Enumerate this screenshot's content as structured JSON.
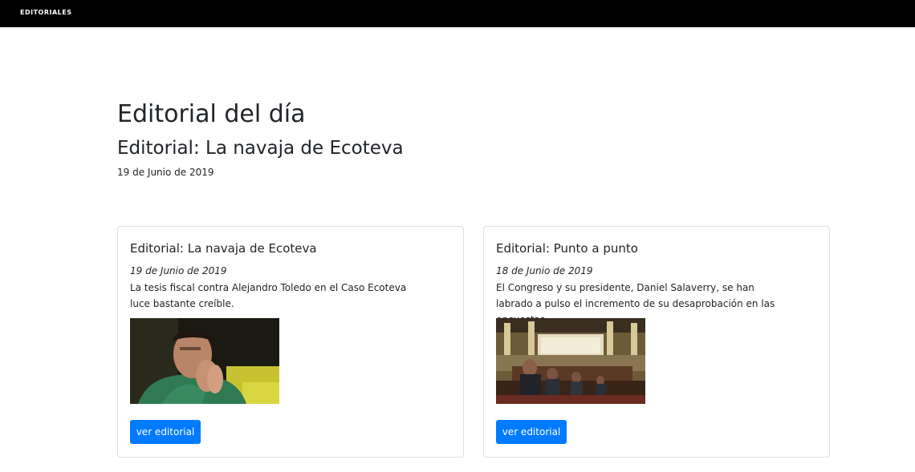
{
  "navbar": {
    "brand": "EDITORIALES"
  },
  "hero": {
    "heading": "Editorial del día",
    "title": "Editorial: La navaja de Ecoteva",
    "date": "19 de Junio de 2019"
  },
  "cards": [
    {
      "title": "Editorial: La navaja de Ecoteva",
      "date": "19 de Junio de 2019",
      "summary": "La tesis fiscal contra Alejandro Toledo en el Caso Ecoteva luce bastante creíble.",
      "button_label": "ver editorial"
    },
    {
      "title": "Editorial: Punto a punto",
      "date": "18 de Junio de 2019",
      "summary": "El Congreso y su presidente, Daniel Salaverry, se han labrado a pulso el incremento de su desaprobación en las encuestas.",
      "button_label": "ver editorial"
    }
  ],
  "colors": {
    "navbar_bg": "#000000",
    "button_bg": "#007bff",
    "text": "#212529",
    "card_border": "#dfdfdf"
  }
}
